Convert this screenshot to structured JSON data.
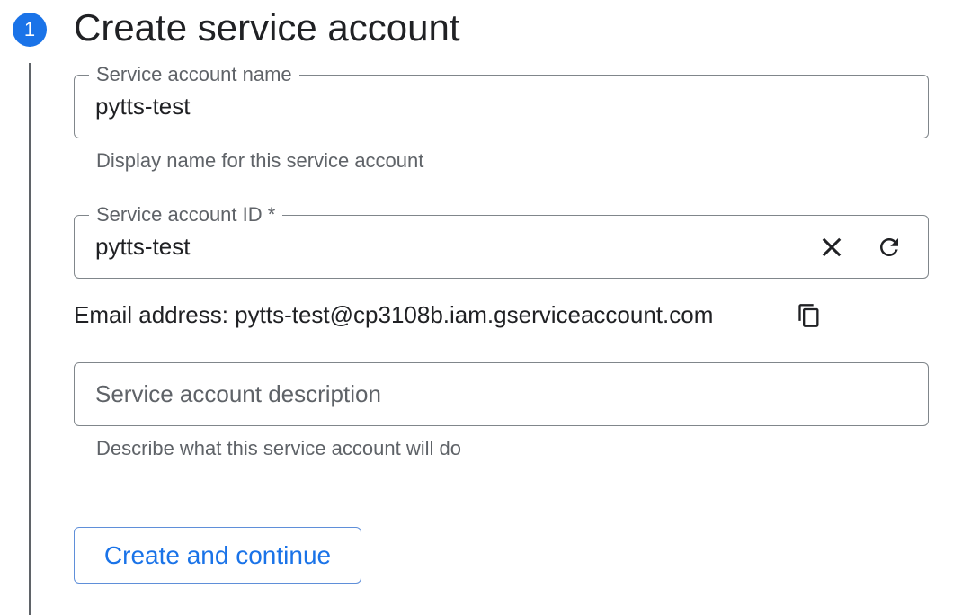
{
  "step": {
    "number": "1",
    "title": "Create service account"
  },
  "fields": {
    "name": {
      "label": "Service account name",
      "value": "pytts-test",
      "hint": "Display name for this service account"
    },
    "id": {
      "label": "Service account ID *",
      "value": "pytts-test",
      "clear_icon": "close-icon",
      "refresh_icon": "refresh-icon"
    },
    "description": {
      "placeholder": "Service account description",
      "value": "",
      "hint": "Describe what this service account will do"
    }
  },
  "email": {
    "text": "Email address: pytts-test@cp3108b.iam.gserviceaccount.com",
    "copy_icon": "copy-icon"
  },
  "actions": {
    "create_label": "Create and continue"
  },
  "colors": {
    "accent": "#1a73e8",
    "border": "#80868b",
    "hint_text": "#5f6368"
  }
}
